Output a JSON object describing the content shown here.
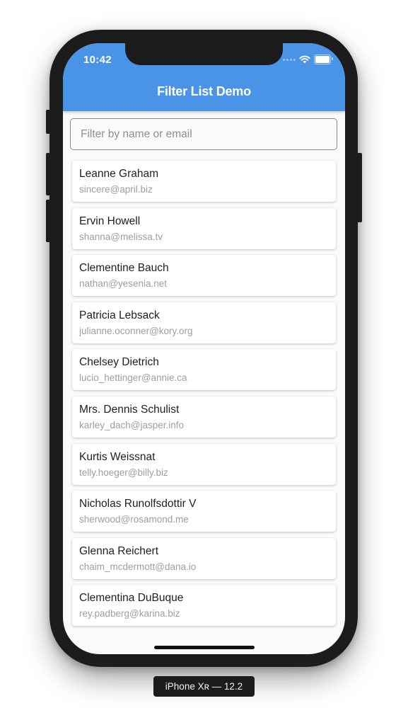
{
  "status_bar": {
    "time": "10:42",
    "icons": [
      "signal-dots-icon",
      "wifi-icon",
      "battery-icon"
    ]
  },
  "app_bar": {
    "title": "Filter List Demo",
    "color": "#4a94e8"
  },
  "search": {
    "placeholder": "Filter by name or email",
    "value": ""
  },
  "users": [
    {
      "name": "Leanne Graham",
      "email": "sincere@april.biz"
    },
    {
      "name": "Ervin Howell",
      "email": "shanna@melissa.tv"
    },
    {
      "name": "Clementine Bauch",
      "email": "nathan@yesenia.net"
    },
    {
      "name": "Patricia Lebsack",
      "email": "julianne.oconner@kory.org"
    },
    {
      "name": "Chelsey Dietrich",
      "email": "lucio_hettinger@annie.ca"
    },
    {
      "name": "Mrs. Dennis Schulist",
      "email": "karley_dach@jasper.info"
    },
    {
      "name": "Kurtis Weissnat",
      "email": "telly.hoeger@billy.biz"
    },
    {
      "name": "Nicholas Runolfsdottir V",
      "email": "sherwood@rosamond.me"
    },
    {
      "name": "Glenna Reichert",
      "email": "chaim_mcdermott@dana.io"
    },
    {
      "name": "Clementina DuBuque",
      "email": "rey.padberg@karina.biz"
    }
  ],
  "device_label": "iPhone Xʀ — 12.2"
}
